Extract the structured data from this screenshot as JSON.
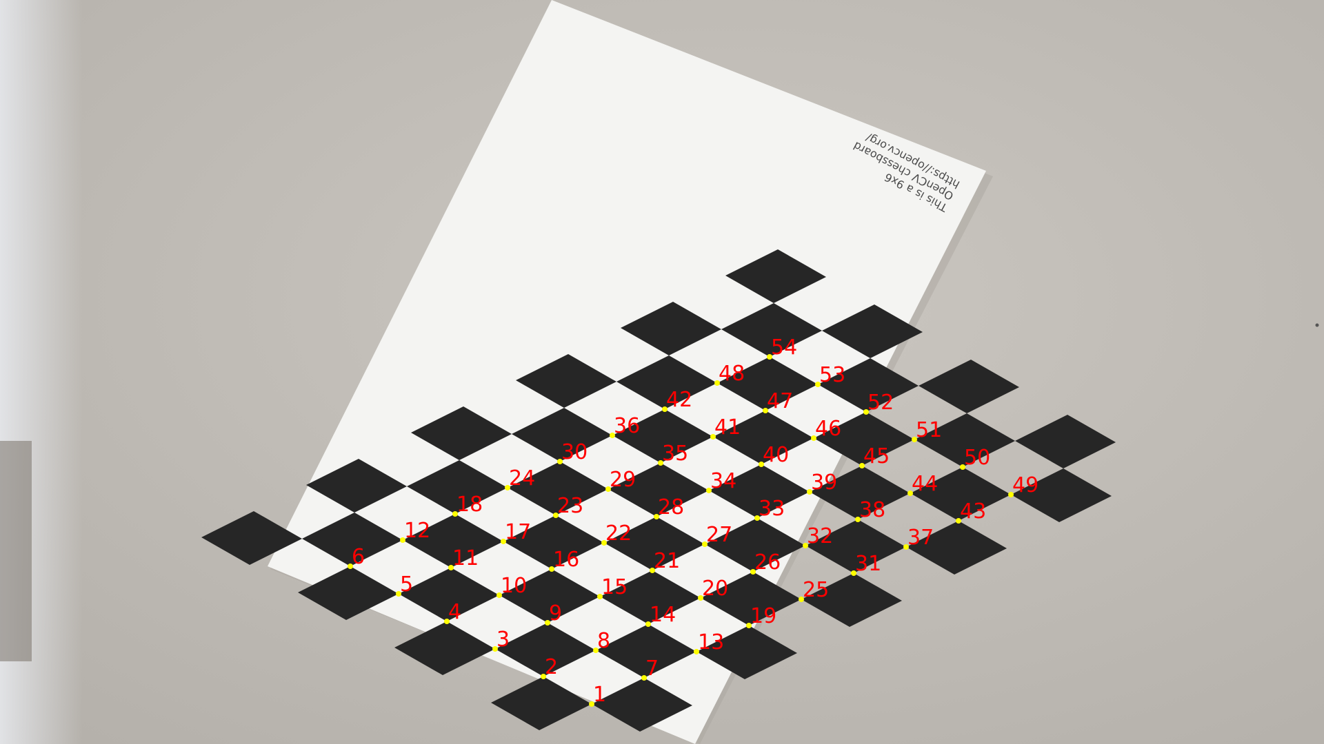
{
  "paper_text": [
    "This is a 9x6",
    "OpenCV chessboard",
    "https://opencv.org/"
  ],
  "detection": {
    "corner_color": "#ffff00",
    "label_color": "#ff0000",
    "corner_labels": [
      "1",
      "2",
      "3",
      "4",
      "5",
      "6",
      "7",
      "8",
      "9",
      "10",
      "11",
      "12",
      "13",
      "14",
      "15",
      "16",
      "17",
      "18",
      "19",
      "20",
      "21",
      "22",
      "23",
      "24",
      "25",
      "26",
      "27",
      "28",
      "29",
      "30",
      "31",
      "32",
      "33",
      "34",
      "35",
      "36",
      "37",
      "38",
      "39",
      "40",
      "41",
      "42",
      "43",
      "44",
      "45",
      "46",
      "47",
      "48",
      "49",
      "50",
      "51",
      "52",
      "53",
      "54"
    ]
  },
  "colors": {
    "wall": "#c6c2bc",
    "paper": "#f4f4f2",
    "square": "#262626"
  }
}
